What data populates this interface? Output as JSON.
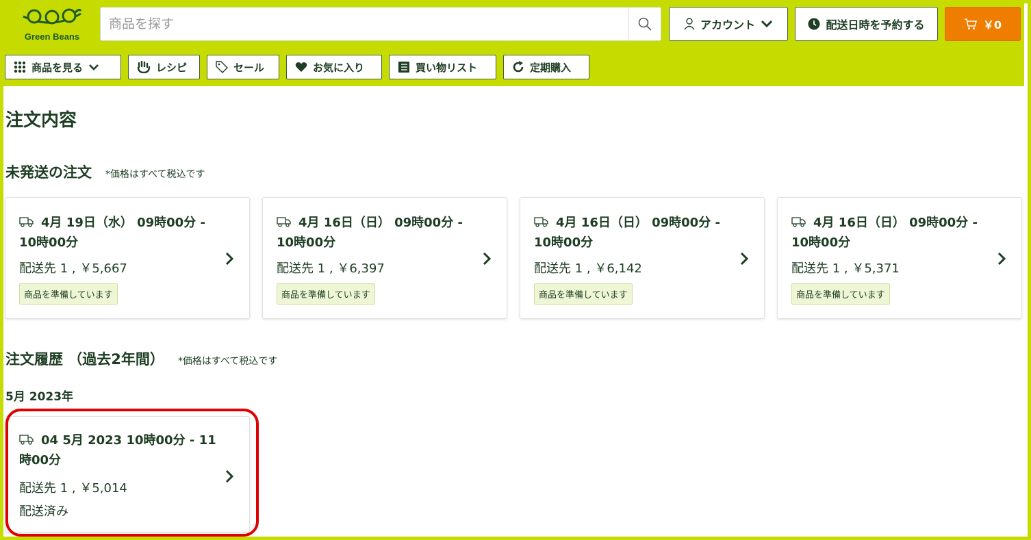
{
  "brand": {
    "name": "Green Beans"
  },
  "search": {
    "placeholder": "商品を探す"
  },
  "header": {
    "account_label": "アカウント",
    "schedule_label": "配送日時を予約する",
    "cart_label": "￥0"
  },
  "nav": [
    {
      "label": "商品を見る",
      "icon": "grid-icon"
    },
    {
      "label": "レシピ",
      "icon": "hand-icon"
    },
    {
      "label": "セール",
      "icon": "tag-icon"
    },
    {
      "label": "お気に入り",
      "icon": "heart-icon"
    },
    {
      "label": "買い物リスト",
      "icon": "list-icon"
    },
    {
      "label": "定期購入",
      "icon": "refresh-icon"
    }
  ],
  "page": {
    "title": "注文内容"
  },
  "pending": {
    "heading": "未発送の注文",
    "note": "*価格はすべて税込です",
    "orders": [
      {
        "date": "4月 19日（水） 09時00分 - 10時00分",
        "address": "配送先 1 , ￥5,667",
        "status": "商品を準備しています"
      },
      {
        "date": "4月 16日（日） 09時00分 - 10時00分",
        "address": "配送先 1 , ￥6,397",
        "status": "商品を準備しています"
      },
      {
        "date": "4月 16日（日） 09時00分 - 10時00分",
        "address": "配送先 1 , ￥6,142",
        "status": "商品を準備しています"
      },
      {
        "date": "4月 16日（日） 09時00分 - 10時00分",
        "address": "配送先 1 , ￥5,371",
        "status": "商品を準備しています"
      }
    ]
  },
  "history": {
    "heading": "注文履歴 （過去2年間）",
    "note": "*価格はすべて税込です",
    "month": "5月 2023年",
    "orders": [
      {
        "date": "04 5月 2023 10時00分 - 11時00分",
        "address": "配送先 1 , ￥5,014",
        "status": "配送済み"
      }
    ]
  },
  "colors": {
    "brand": "#c6dc00",
    "cart": "#ef7d00",
    "text": "#1e3d23",
    "highlight": "#e10000"
  }
}
